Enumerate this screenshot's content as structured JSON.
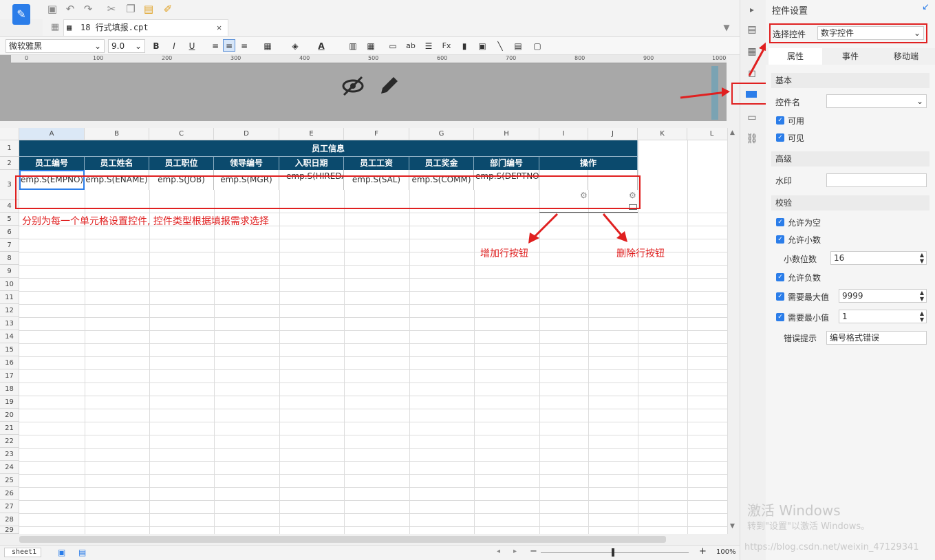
{
  "tab": {
    "title": "18 行式填报.cpt"
  },
  "format_bar": {
    "font_name": "微软雅黑",
    "font_size": "9.0"
  },
  "ruler_ticks": [
    "0",
    "100",
    "200",
    "300",
    "400",
    "500",
    "600",
    "700",
    "800",
    "900",
    "1000"
  ],
  "columns": [
    "A",
    "B",
    "C",
    "D",
    "E",
    "F",
    "G",
    "H",
    "I",
    "J",
    "K",
    "L"
  ],
  "rows": [
    "1",
    "2",
    "3",
    "4",
    "5",
    "6",
    "7",
    "8",
    "9",
    "10",
    "11",
    "12",
    "13",
    "14",
    "15",
    "16",
    "17",
    "18",
    "19",
    "20",
    "21",
    "22",
    "23",
    "24",
    "25",
    "26",
    "27",
    "28",
    "29"
  ],
  "sheet": {
    "title": "员工信息",
    "headers": [
      "员工编号",
      "员工姓名",
      "员工职位",
      "领导编号",
      "入职日期",
      "员工工资",
      "员工奖金",
      "部门编号",
      "操作"
    ],
    "cells": [
      "emp.S(EMPNO)",
      "emp.S(ENAME)",
      "emp.S(JOB)",
      "emp.S(MGR)",
      "emp.S(HIREDATE)",
      "emp.S(SAL)",
      "emp.S(COMM)",
      "emp.S(DEPTNO)"
    ]
  },
  "annotations": {
    "note": "分别为每一个单元格设置控件, 控件类型根据填报需求选择",
    "add_row": "增加行按钮",
    "del_row": "删除行按钮"
  },
  "status": {
    "sheet_tab": "sheet1",
    "zoom": "100%"
  },
  "panel": {
    "title": "控件设置",
    "select_label": "选择控件",
    "select_value": "数字控件",
    "tabs": [
      "属性",
      "事件",
      "移动端"
    ],
    "basic": "基本",
    "name_label": "控件名",
    "enabled": "可用",
    "visible": "可见",
    "advanced": "高级",
    "watermark_label": "水印",
    "validation": "校验",
    "allow_empty": "允许为空",
    "allow_decimal": "允许小数",
    "decimal_places_label": "小数位数",
    "decimal_places": "16",
    "allow_negative": "允许负数",
    "need_max": "需要最大值",
    "max_value": "9999",
    "need_min": "需要最小值",
    "min_value": "1",
    "error_label": "错误提示",
    "error_value": "编号格式错误"
  },
  "os_watermark": {
    "line1": "激活 Windows",
    "line2": "转到\"设置\"以激活 Windows。",
    "url": "https://blog.csdn.net/weixin_47129341"
  },
  "colors": {
    "header_bg": "#0b4a6d",
    "accent": "#2b7de9",
    "annotation": "#e02020"
  }
}
